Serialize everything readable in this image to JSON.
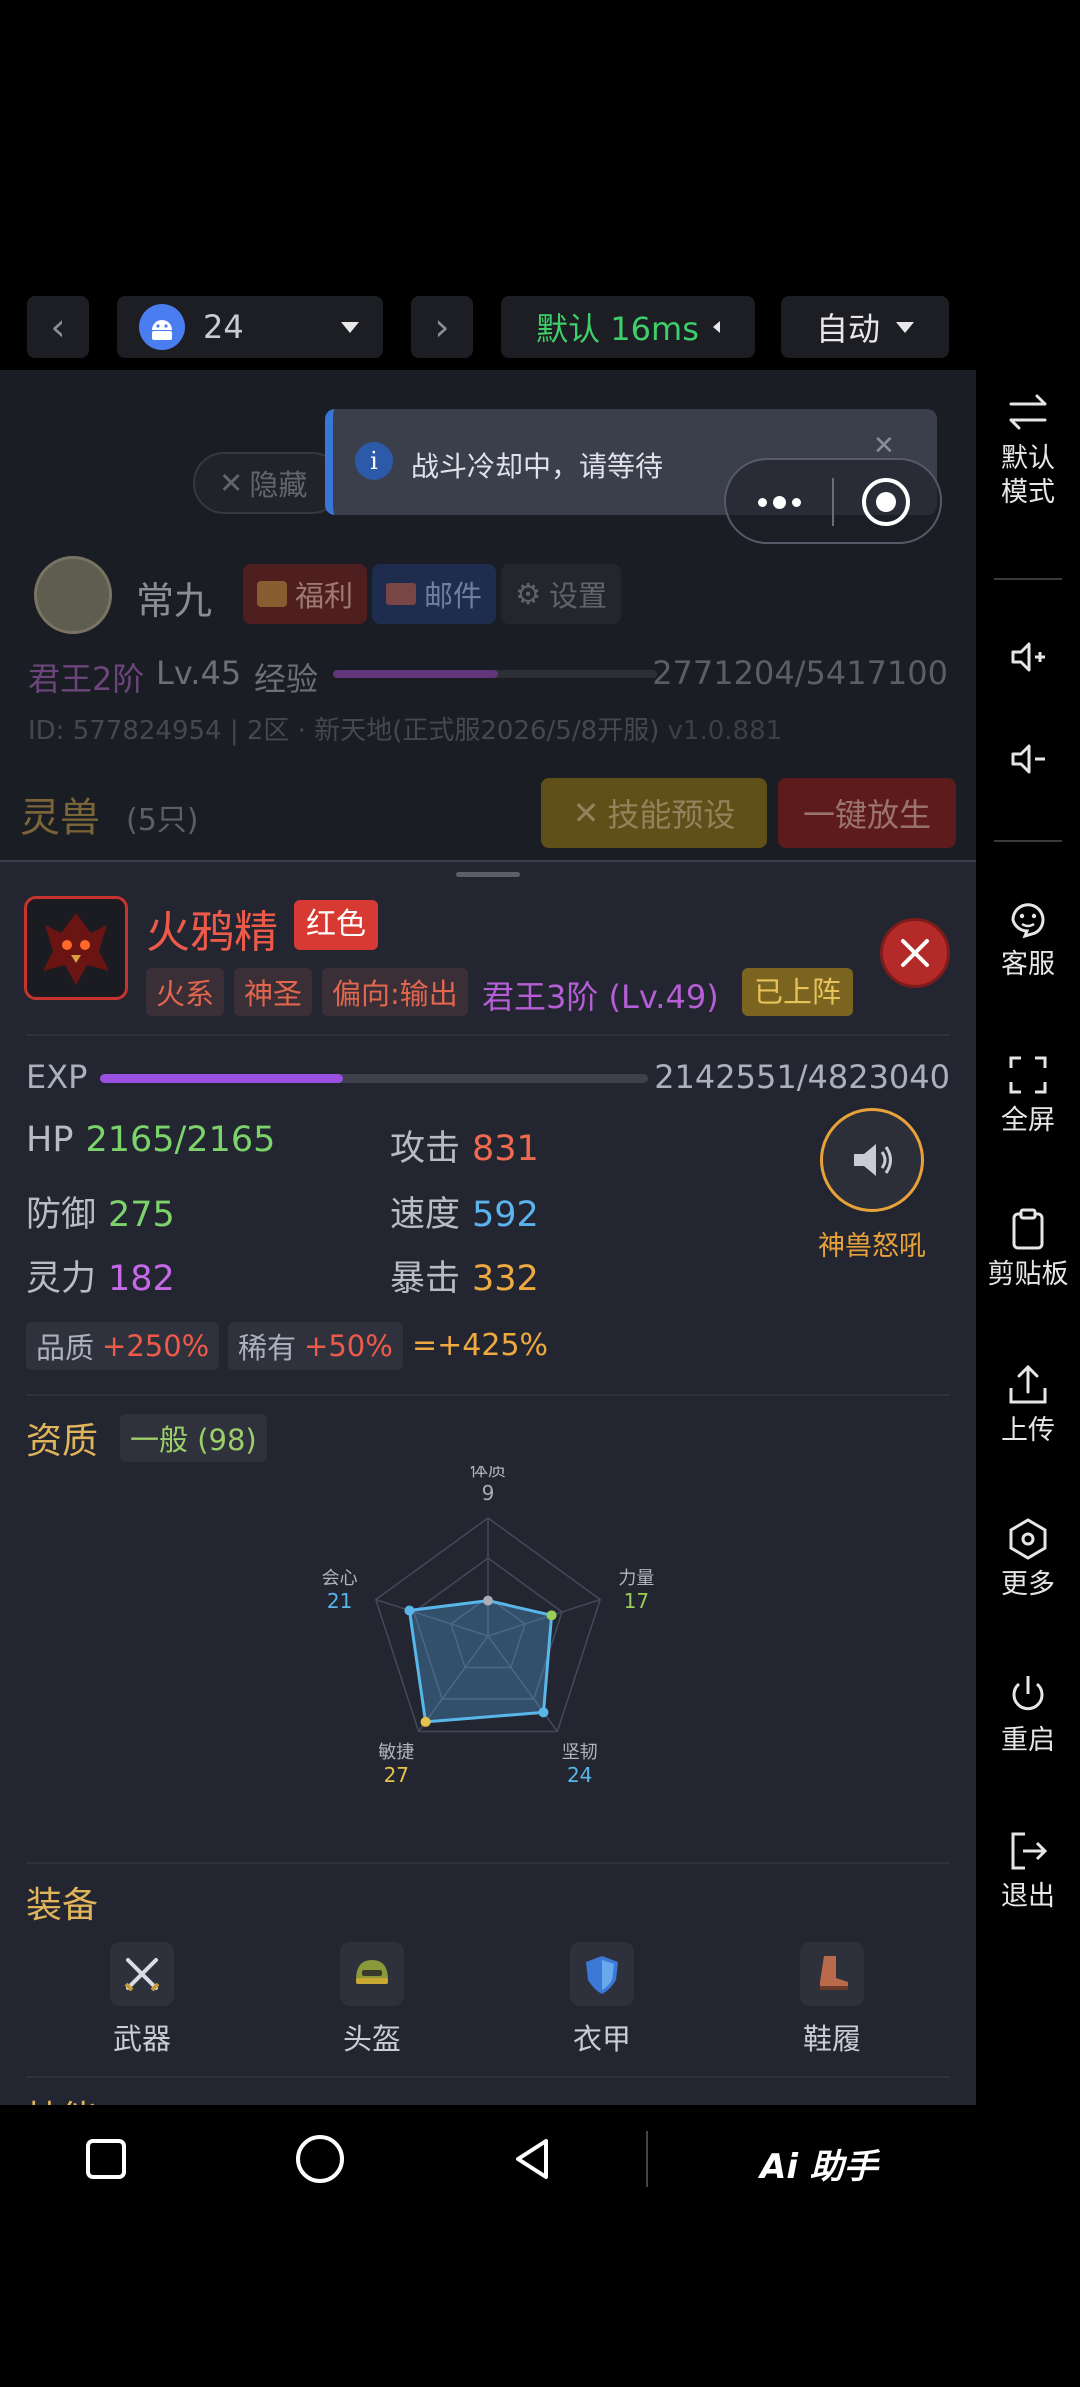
{
  "toolbar": {
    "device_number": "24",
    "latency_label": "默认 16ms",
    "mode_label": "自动"
  },
  "sidebar": {
    "items": [
      {
        "label": "默认\n模式",
        "icon": "swap-icon"
      },
      {
        "label": "",
        "icon": "volume-up-icon"
      },
      {
        "label": "",
        "icon": "volume-down-icon"
      },
      {
        "label": "客服",
        "icon": "customer-service-icon"
      },
      {
        "label": "全屏",
        "icon": "fullscreen-icon"
      },
      {
        "label": "剪贴板",
        "icon": "clipboard-icon"
      },
      {
        "label": "上传",
        "icon": "upload-icon"
      },
      {
        "label": "更多",
        "icon": "more-icon"
      },
      {
        "label": "重启",
        "icon": "power-icon"
      },
      {
        "label": "退出",
        "icon": "exit-icon"
      }
    ]
  },
  "toast": {
    "text": "战斗冷却中，请等待"
  },
  "player": {
    "hide_label": "隐藏",
    "name": "常九",
    "welfare_label": "福利",
    "mail_label": "邮件",
    "settings_label": "设置",
    "rank": "君王2阶",
    "level": "Lv.45",
    "exp_label": "经验",
    "exp_value": "2771204/5417100",
    "exp_fraction": 0.51,
    "id_line": "ID: 577824954 | 2区 · 新天地(正式服2026/5/8开服)",
    "version": "v1.0.881"
  },
  "pets": {
    "title": "灵兽",
    "count": "(5只)",
    "skill_preset_label": "技能预设",
    "release_all_label": "一键放生"
  },
  "pet": {
    "name": "火鸦精",
    "quality_badge": "红色",
    "element": "火系",
    "tier": "神圣",
    "bias": "偏向:输出",
    "rank_level": "君王3阶 (Lv.49)",
    "status": "已上阵",
    "exp_label": "EXP",
    "exp_value": "2142551/4823040",
    "exp_fraction": 0.444,
    "stats": {
      "hp_label": "HP",
      "hp": "2165/2165",
      "atk_label": "攻击",
      "atk": "831",
      "def_label": "防御",
      "def": "275",
      "spd_label": "速度",
      "spd": "592",
      "spirit_label": "灵力",
      "spirit": "182",
      "crit_label": "暴击",
      "crit": "332"
    },
    "skill_name": "神兽怒吼",
    "bonus": {
      "quality_label": "品质",
      "quality_value": "+250%",
      "rare_label": "稀有",
      "rare_value": "+50%",
      "total": "=+425%"
    },
    "aptitude_title": "资质",
    "aptitude_grade": "一般 (98)"
  },
  "chart_data": {
    "type": "radar",
    "categories": [
      "体质",
      "力量",
      "坚韧",
      "敏捷",
      "会心"
    ],
    "values": [
      9,
      17,
      24,
      27,
      21
    ],
    "value_colors": [
      "#a8adb8",
      "#9acd5a",
      "#58b6e8",
      "#e6c24a",
      "#58b6e8"
    ],
    "max": 30
  },
  "equipment": {
    "title": "装备",
    "slots": [
      {
        "label": "武器",
        "icon": "swords-icon"
      },
      {
        "label": "头盔",
        "icon": "helmet-icon"
      },
      {
        "label": "衣甲",
        "icon": "shield-icon"
      },
      {
        "label": "鞋履",
        "icon": "boot-icon"
      }
    ]
  },
  "skills": {
    "title": "技能"
  },
  "nav": {
    "assistant_label": "Ai 助手"
  }
}
